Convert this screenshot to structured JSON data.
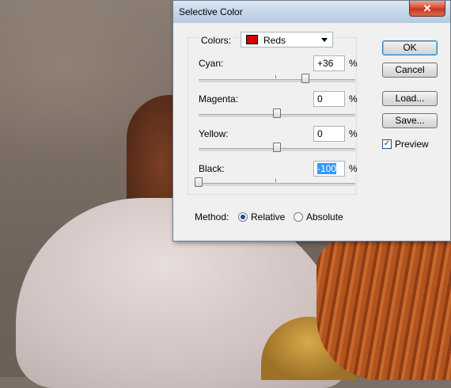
{
  "dialog": {
    "title": "Selective Color",
    "close_glyph": "✕"
  },
  "colors": {
    "label": "Colors:",
    "selected": "Reds",
    "swatch_color": "#d40000"
  },
  "sliders": [
    {
      "label": "Cyan:",
      "value": "+36",
      "unit": "%",
      "level": 0.68
    },
    {
      "label": "Magenta:",
      "value": "0",
      "unit": "%",
      "level": 0.5
    },
    {
      "label": "Yellow:",
      "value": "0",
      "unit": "%",
      "level": 0.5
    },
    {
      "label": "Black:",
      "value": "-100",
      "unit": "%",
      "level": 0.0
    }
  ],
  "buttons": {
    "ok": "OK",
    "cancel": "Cancel",
    "load": "Load...",
    "save": "Save..."
  },
  "preview": {
    "label": "Preview",
    "checked": true,
    "check_glyph": "✓"
  },
  "method": {
    "label": "Method:",
    "relative": "Relative",
    "absolute": "Absolute",
    "selected": "Relative"
  }
}
